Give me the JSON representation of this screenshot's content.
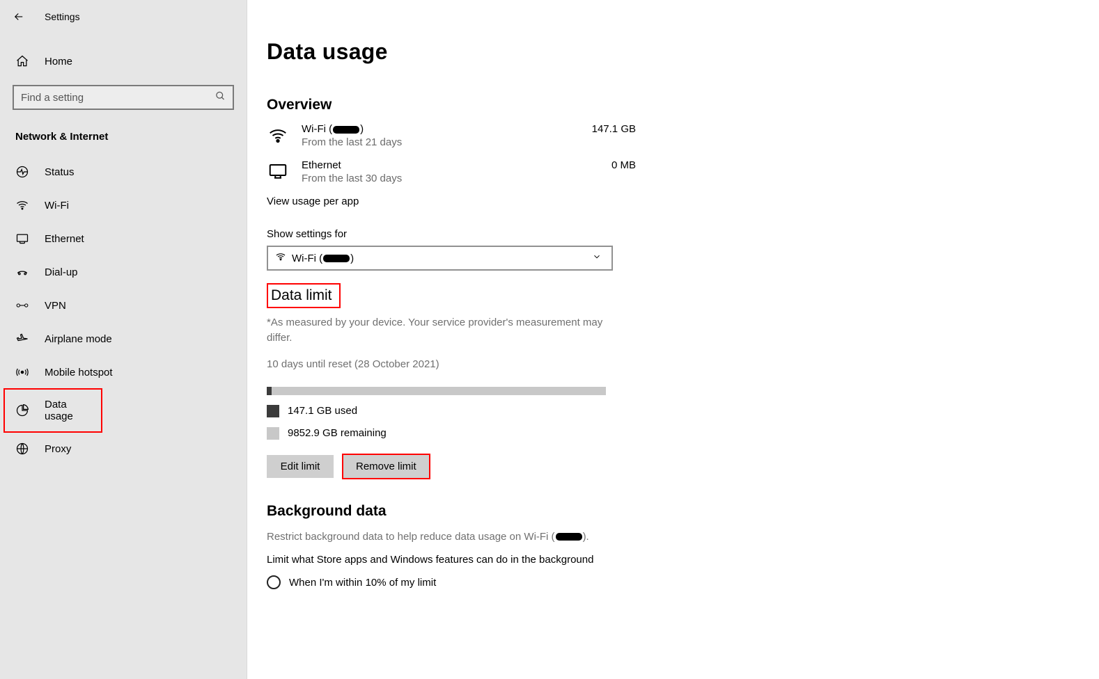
{
  "sidebar": {
    "title": "Settings",
    "home": "Home",
    "search_placeholder": "Find a setting",
    "category": "Network & Internet",
    "items": [
      {
        "label": "Status",
        "icon": "status"
      },
      {
        "label": "Wi-Fi",
        "icon": "wifi"
      },
      {
        "label": "Ethernet",
        "icon": "ethernet"
      },
      {
        "label": "Dial-up",
        "icon": "dialup"
      },
      {
        "label": "VPN",
        "icon": "vpn"
      },
      {
        "label": "Airplane mode",
        "icon": "airplane"
      },
      {
        "label": "Mobile hotspot",
        "icon": "hotspot"
      },
      {
        "label": "Data usage",
        "icon": "datausage"
      },
      {
        "label": "Proxy",
        "icon": "proxy"
      }
    ]
  },
  "main": {
    "title": "Data usage",
    "overview": {
      "heading": "Overview",
      "rows": [
        {
          "name_pre": "Wi-Fi (",
          "name_post": ")",
          "sub": "From the last 21 days",
          "value": "147.1 GB"
        },
        {
          "name": "Ethernet",
          "sub": "From the last 30 days",
          "value": "0 MB"
        }
      ],
      "view_per_app": "View usage per app"
    },
    "show_settings_label": "Show settings for",
    "dropdown_pre": "Wi-Fi (",
    "dropdown_post": ")",
    "data_limit": {
      "heading": "Data limit",
      "note": "*As measured by your device. Your service provider's measurement may differ.",
      "reset": "10 days until reset (28 October 2021)",
      "used": "147.1 GB used",
      "remaining": "9852.9 GB remaining",
      "edit_btn": "Edit limit",
      "remove_btn": "Remove limit"
    },
    "background": {
      "heading": "Background data",
      "desc_pre": "Restrict background data to help reduce data usage on Wi-Fi (",
      "desc_post": ").",
      "sub": "Limit what Store apps and Windows features can do in the background",
      "radio1": "When I'm within 10% of my limit"
    }
  }
}
